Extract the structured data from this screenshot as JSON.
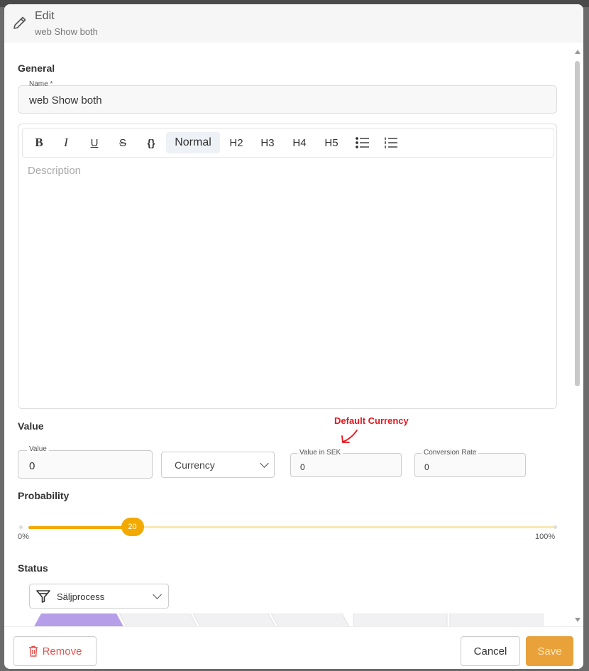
{
  "header": {
    "title": "Edit",
    "subtitle": "web Show both"
  },
  "general": {
    "section_title": "General",
    "name_label": "Name *",
    "name_value": "web Show both",
    "toolbar": {
      "bold": "B",
      "italic": "I",
      "underline": "U",
      "strike": "S",
      "code": "{}",
      "normal": "Normal",
      "h2": "H2",
      "h3": "H3",
      "h4": "H4",
      "h5": "H5"
    },
    "description_placeholder": "Description"
  },
  "value": {
    "section_title": "Value",
    "value_label": "Value",
    "value_value": "0",
    "currency_value": "Currency",
    "annotation": "Default Currency",
    "value_in_sek_label": "Value in SEK",
    "value_in_sek_value": "0",
    "conversion_rate_label": "Conversion Rate",
    "conversion_rate_value": "0"
  },
  "probability": {
    "section_title": "Probability",
    "value": 20,
    "value_label": "20",
    "min_label": "0%",
    "max_label": "100%",
    "colors": {
      "fill": "#f2a900",
      "track": "#fbe7b0"
    }
  },
  "status": {
    "section_title": "Status",
    "select_value": "Säljprocess",
    "icon": "funnel-icon"
  },
  "footer": {
    "remove_label": "Remove",
    "cancel_label": "Cancel",
    "save_label": "Save"
  }
}
